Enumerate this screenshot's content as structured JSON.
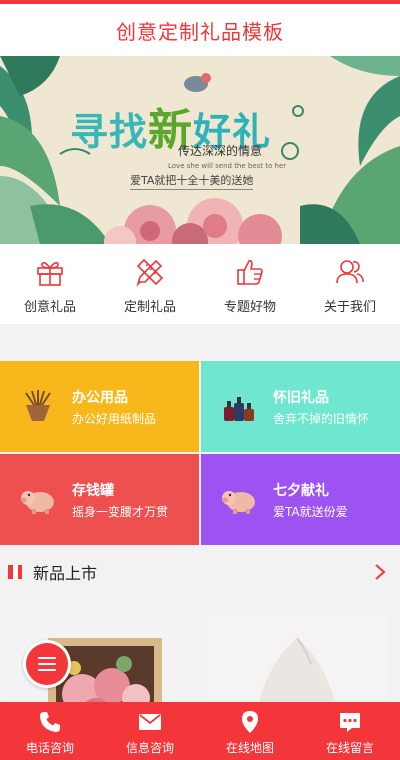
{
  "header": {
    "title": "创意定制礼品模板"
  },
  "banner": {
    "headline_start": "寻找",
    "headline_mid": "新",
    "headline_end": "好礼",
    "subtitle": "传达深深的情意",
    "english_line": "Love she will send the best to her",
    "tagline": "爱TA就把十全十美的送她"
  },
  "quick_nav": [
    {
      "label": "创意礼品",
      "icon": "gift-icon"
    },
    {
      "label": "定制礼品",
      "icon": "pencil-ruler-icon"
    },
    {
      "label": "专题好物",
      "icon": "thumbs-up-icon"
    },
    {
      "label": "关于我们",
      "icon": "people-icon"
    }
  ],
  "tiles": [
    {
      "title": "办公用品",
      "subtitle": "办公好用纸制品",
      "color": "#f8b81b",
      "icon": "pen-holder-icon"
    },
    {
      "title": "怀旧礼品",
      "subtitle": "舍弃不掉的旧情怀",
      "color": "#6fe6cf",
      "icon": "perfume-bottles-icon"
    },
    {
      "title": "存钱罐",
      "subtitle": "摇身一变腰才万贯",
      "color": "#ee5050",
      "icon": "piggy-bank-icon"
    },
    {
      "title": "七夕献礼",
      "subtitle": "爱TA就送份爱",
      "color": "#9d52f2",
      "icon": "piggy-bank-icon"
    }
  ],
  "section": {
    "title": "新品上市"
  },
  "bottom_nav": [
    {
      "label": "电话咨询",
      "icon": "phone-icon"
    },
    {
      "label": "信息咨询",
      "icon": "mail-icon"
    },
    {
      "label": "在线地图",
      "icon": "map-pin-icon"
    },
    {
      "label": "在线留言",
      "icon": "chat-icon"
    }
  ],
  "colors": {
    "accent": "#f2363a",
    "flag_white": "#ffffff"
  }
}
